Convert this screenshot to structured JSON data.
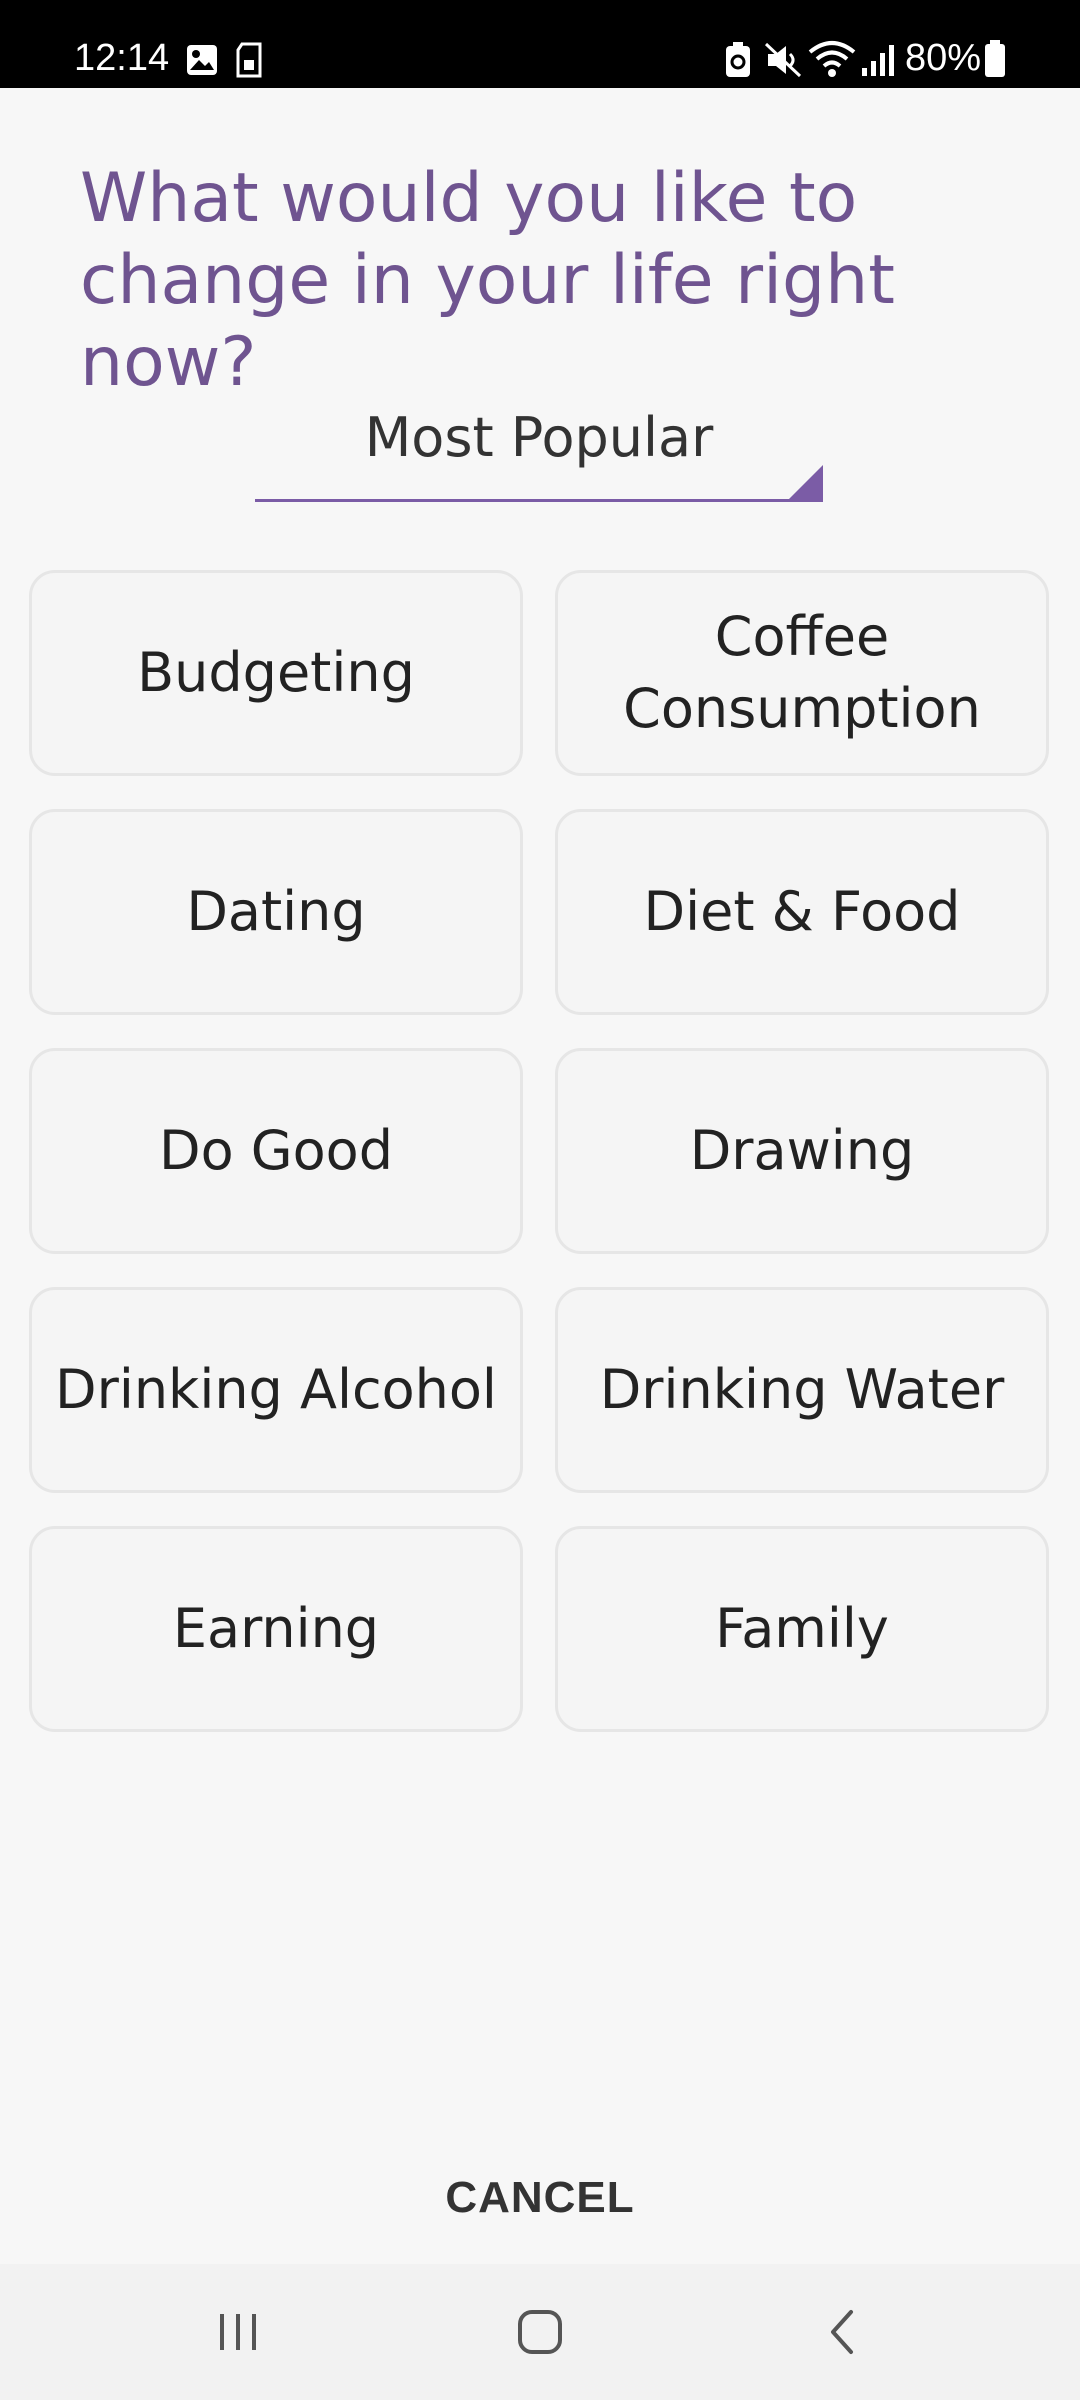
{
  "status_bar": {
    "time": "12:14",
    "battery": "80%",
    "icons": [
      "image-icon",
      "sim-icon",
      "battery-saver-icon",
      "mute-icon",
      "wifi-icon",
      "signal-icon",
      "battery-icon"
    ]
  },
  "header": {
    "title": "What would you like to\nchange in your life right now?"
  },
  "filter": {
    "selected": "Most Popular",
    "icon": "dropdown-triangle-icon"
  },
  "categories": [
    "Budgeting",
    "Coffee\nConsumption",
    "Dating",
    "Diet & Food",
    "Do Good",
    "Drawing",
    "Drinking Alcohol",
    "Drinking Water",
    "Earning",
    "Family"
  ],
  "footer": {
    "cancel_label": "CANCEL"
  },
  "nav_bar": {
    "buttons": [
      "recent-apps-icon",
      "home-icon",
      "back-icon"
    ]
  },
  "colors": {
    "accent": "#7b5ca6",
    "title": "#6f5490",
    "background": "#f7f7f7",
    "tile_border": "#e6e6e6"
  }
}
